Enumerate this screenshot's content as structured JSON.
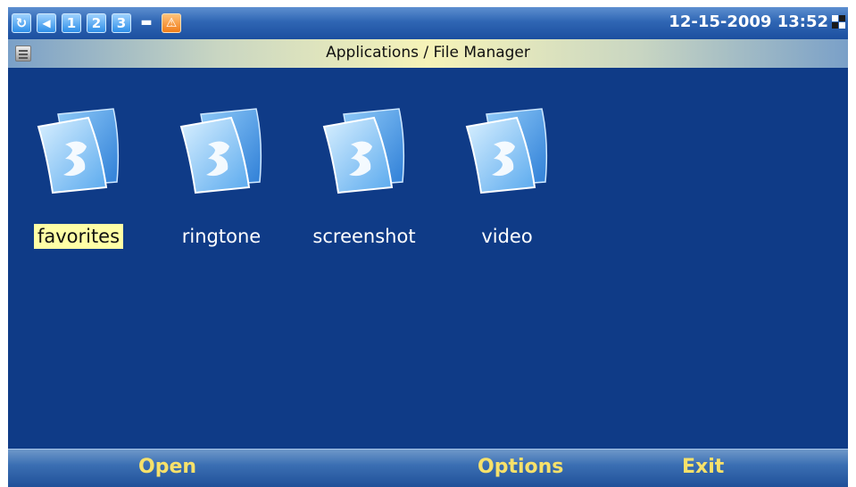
{
  "statusbar": {
    "icons": [
      {
        "name": "sync-icon",
        "glyph": "↻"
      },
      {
        "name": "volume-icon",
        "glyph": "◀"
      },
      {
        "name": "line-1-icon",
        "glyph": "1"
      },
      {
        "name": "line-2-icon",
        "glyph": "2"
      },
      {
        "name": "line-3-icon",
        "glyph": "3"
      },
      {
        "name": "network-icon",
        "glyph": "▬"
      },
      {
        "name": "alert-icon",
        "glyph": "⚠"
      }
    ],
    "datetime": "12-15-2009 13:52"
  },
  "titlebar": {
    "title": "Applications / File Manager"
  },
  "folders": [
    {
      "label": "favorites",
      "selected": true
    },
    {
      "label": "ringtone",
      "selected": false
    },
    {
      "label": "screenshot",
      "selected": false
    },
    {
      "label": "video",
      "selected": false
    }
  ],
  "softkeys": {
    "left": "Open",
    "middle": "Options",
    "right": "Exit"
  },
  "colors": {
    "background": "#0f3b87",
    "selection": "#ffffa6",
    "softkey_text": "#f7e16a"
  }
}
